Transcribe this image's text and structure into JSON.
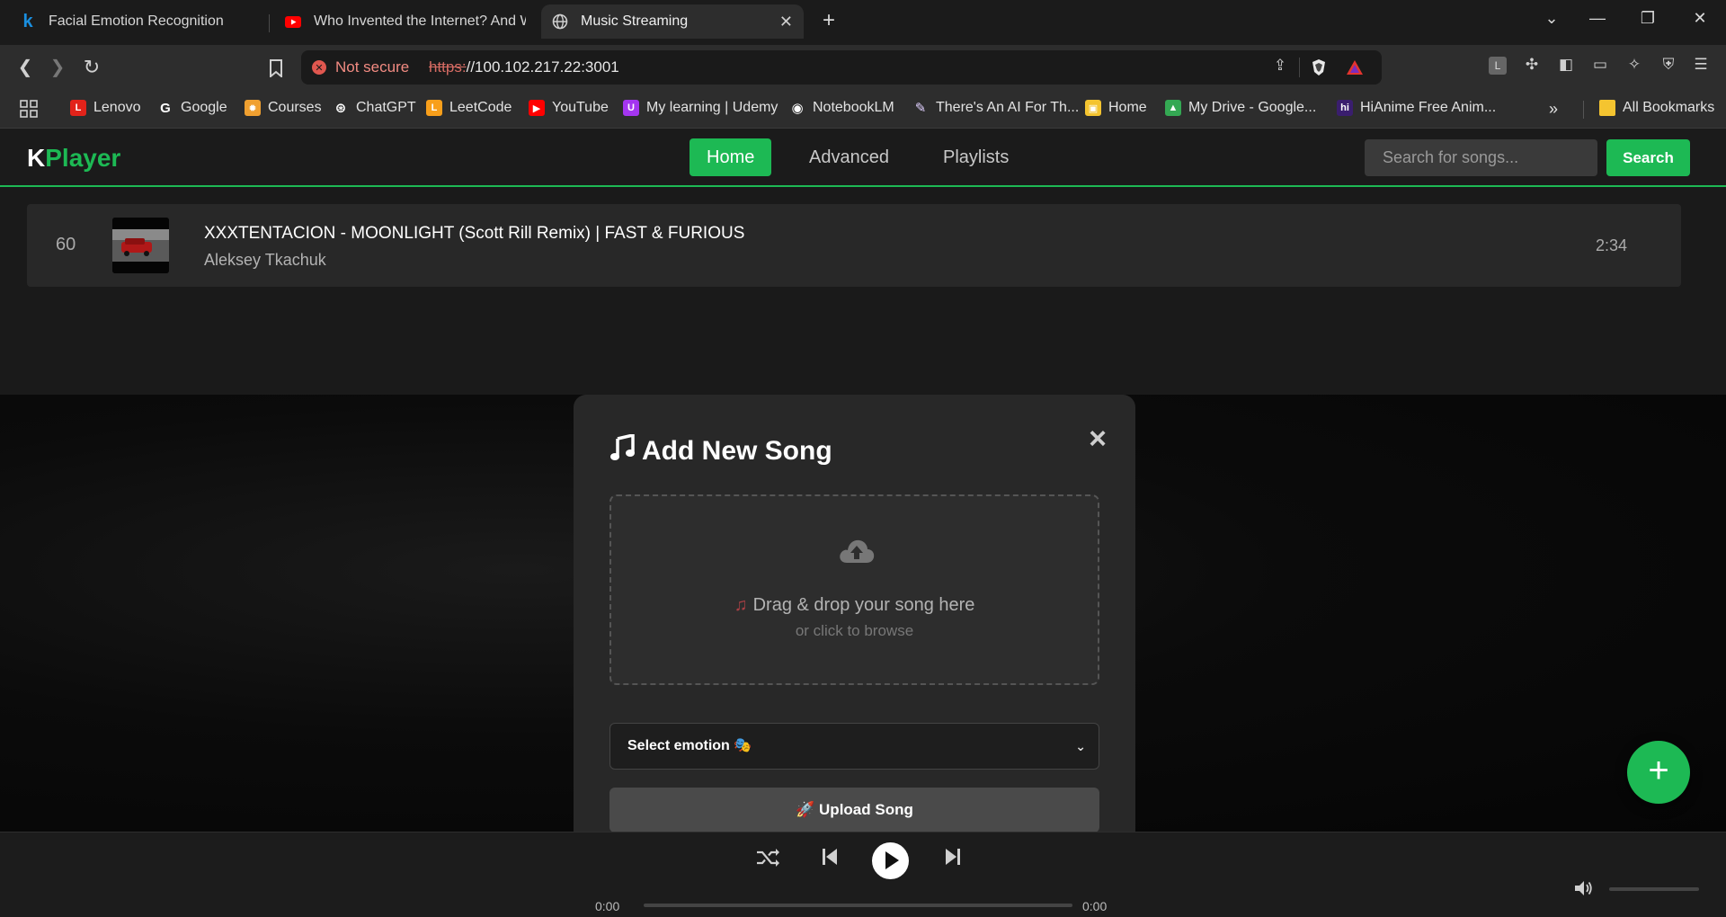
{
  "browser": {
    "tabs": [
      {
        "title": "Facial Emotion Recognition",
        "icon": "k-logo-icon"
      },
      {
        "title": "Who Invented the Internet? And Wh",
        "icon": "youtube-icon"
      },
      {
        "title": "Music Streaming",
        "icon": "globe-icon"
      }
    ],
    "not_secure_label": "Not secure",
    "url_protocol": "https:",
    "url_rest": "//100.102.217.22:3001",
    "bookmarks": [
      {
        "label": "Lenovo",
        "color": "#e2231a",
        "glyph": "L"
      },
      {
        "label": "Google",
        "color": "#ffffff",
        "glyph": "G"
      },
      {
        "label": "Courses",
        "color": "#f0a030",
        "glyph": "✹"
      },
      {
        "label": "ChatGPT",
        "color": "#ffffff",
        "glyph": "⊛"
      },
      {
        "label": "LeetCode",
        "color": "#f89f1b",
        "glyph": "L"
      },
      {
        "label": "YouTube",
        "color": "#ff0000",
        "glyph": "▶"
      },
      {
        "label": "My learning | Udemy",
        "color": "#a435f0",
        "glyph": "U"
      },
      {
        "label": "NotebookLM",
        "color": "#ffffff",
        "glyph": "◉"
      },
      {
        "label": "There's An AI For Th...",
        "color": "#e0d0ff",
        "glyph": "✎"
      },
      {
        "label": "Home",
        "color": "#f4c430",
        "glyph": "▣"
      },
      {
        "label": "My Drive - Google...",
        "color": "#34a853",
        "glyph": "▲"
      },
      {
        "label": "HiAnime Free Anim...",
        "color": "#3a1e6e",
        "glyph": "hi"
      }
    ],
    "all_bookmarks_label": "All Bookmarks"
  },
  "app": {
    "logo_k": "K",
    "logo_rest": "Player",
    "nav": {
      "home": "Home",
      "advanced": "Advanced",
      "playlists": "Playlists"
    },
    "search": {
      "placeholder": "Search for songs...",
      "button": "Search"
    },
    "song": {
      "number": "60",
      "title": "XXXTENTACION - MOONLIGHT (Scott Rill Remix) | FAST & FURIOUS",
      "artist": "Aleksey Tkachuk",
      "duration": "2:34"
    },
    "modal": {
      "title": "Add New Song",
      "close": "×",
      "drop_text": "Drag & drop your song here",
      "drop_sub": "or click to browse",
      "select_label": "Select emotion 🎭",
      "upload_label": "🚀 Upload Song"
    },
    "fab": "+",
    "player": {
      "current_time": "0:00",
      "total_time": "0:00",
      "progress_fraction": 0,
      "volume_fraction": 0
    }
  },
  "colors": {
    "accent": "#1db954",
    "background": "#121212"
  }
}
